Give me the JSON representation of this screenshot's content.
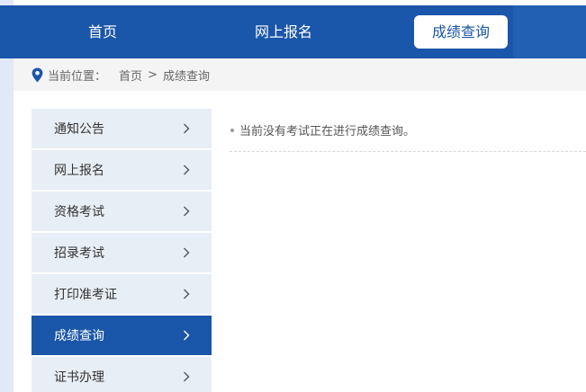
{
  "topnav": {
    "items": [
      {
        "label": "首页"
      },
      {
        "label": "网上报名"
      },
      {
        "label": "成绩查询",
        "active": true
      }
    ],
    "bg_color": "#1a56a9"
  },
  "breadcrumb": {
    "icon": "location-pin-icon",
    "prefix": "当前位置：",
    "home": "首页",
    "separator": ">",
    "current": "成绩查询"
  },
  "sidebar": {
    "items": [
      {
        "label": "通知公告"
      },
      {
        "label": "网上报名"
      },
      {
        "label": "资格考试"
      },
      {
        "label": "招录考试"
      },
      {
        "label": "打印准考证"
      },
      {
        "label": "成绩查询",
        "active": true
      },
      {
        "label": "证书办理"
      }
    ],
    "item_icon": "chevron-right-icon",
    "active_color": "#1a56a9",
    "inactive_color": "#e8eef6"
  },
  "content": {
    "notice": "当前没有考试正在进行成绩查询。"
  }
}
